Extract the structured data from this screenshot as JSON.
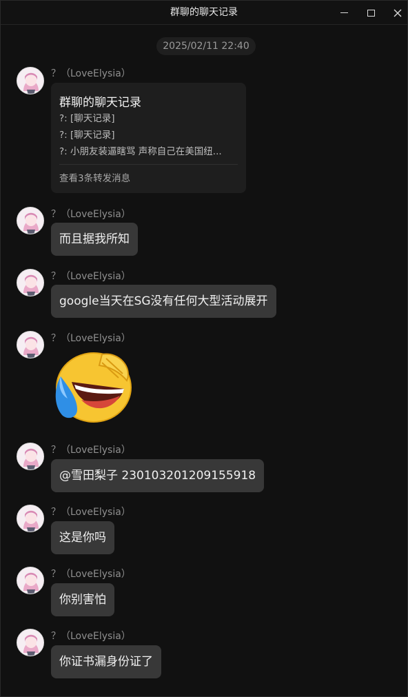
{
  "window": {
    "title": "群聊的聊天记录",
    "controls": [
      "minimize-icon",
      "maximize-icon",
      "close-icon"
    ]
  },
  "date_separator": "2025/02/11 22:40",
  "forward_card": {
    "sender": "？（LoveElysia）",
    "title": "群聊的聊天记录",
    "lines": [
      "?: [聊天记录]",
      "?: [聊天记录]",
      "?: 小朋友装逼瞎骂 声称自己在美国纽..."
    ],
    "footer": "查看3条转发消息"
  },
  "messages": [
    {
      "sender": "？（LoveElysia）",
      "text": "而且据我所知"
    },
    {
      "sender": "？（LoveElysia）",
      "text": "google当天在SG没有任何大型活动展开"
    },
    {
      "sender": "？（LoveElysia）",
      "sticker": "laughing-crying-emoji-icon"
    },
    {
      "sender": "？（LoveElysia）",
      "text": "@雪田梨子 230103201209155918"
    },
    {
      "sender": "？（LoveElysia）",
      "text": "这是你吗"
    },
    {
      "sender": "？（LoveElysia）",
      "text": "你别害怕"
    },
    {
      "sender": "？（LoveElysia）",
      "text": "你证书漏身份证了"
    }
  ]
}
